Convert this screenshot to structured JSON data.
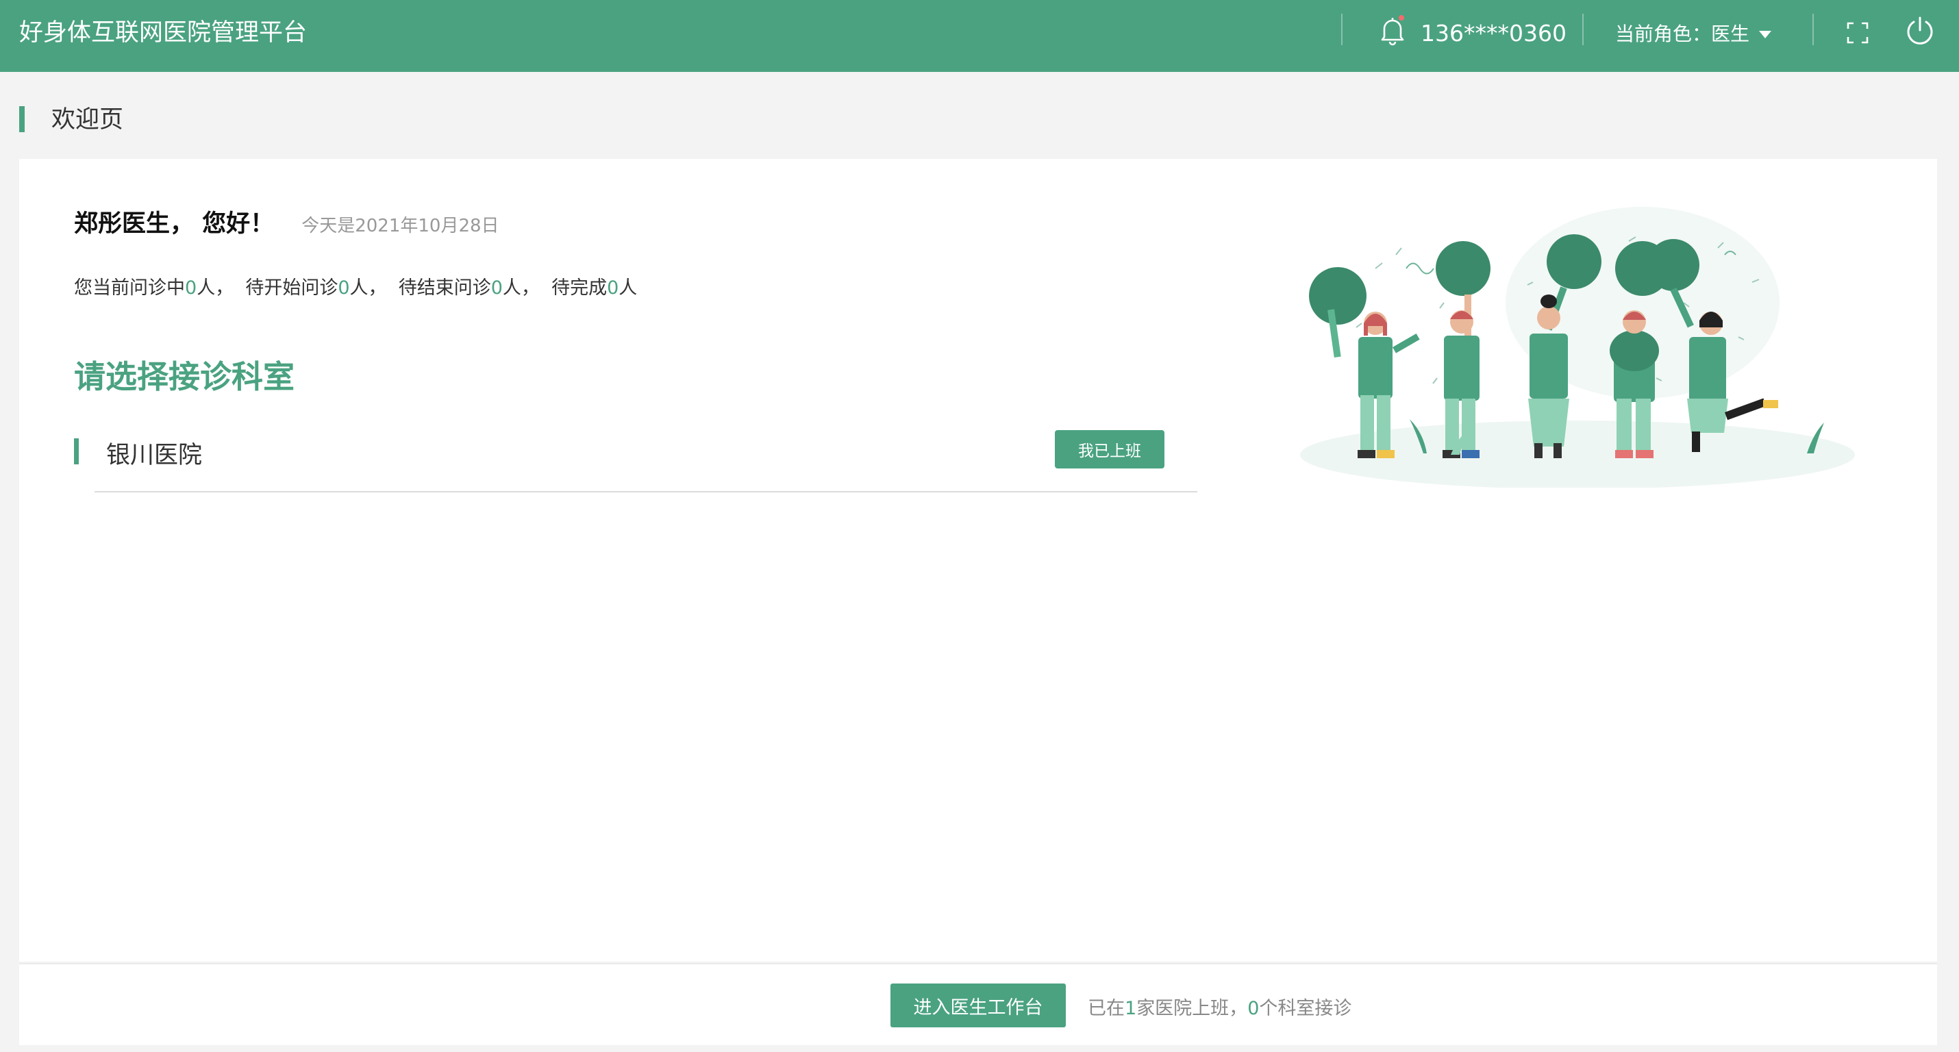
{
  "header": {
    "app_title": "好身体互联网医院管理平台",
    "phone": "136****0360",
    "role_label": "当前角色：医生",
    "colors": {
      "brand": "#4aa281",
      "notify_dot": "#f56c6c"
    },
    "icons": [
      "bell-icon",
      "chevron-down-icon",
      "fullscreen-icon",
      "power-icon"
    ]
  },
  "page": {
    "title": "欢迎页"
  },
  "welcome": {
    "greeting": "郑彤医生， 您好！",
    "date": "今天是2021年10月28日",
    "stats": {
      "l1": "您当前问诊中",
      "v1": "0",
      "u1": "人，",
      "l2": "待开始问诊",
      "v2": "0",
      "u2": "人，",
      "l3": "待结束问诊",
      "v3": "0",
      "u3": "人，",
      "l4": "待完成",
      "v4": "0",
      "u4": "人"
    },
    "choose_title": "请选择接诊科室",
    "hospital": {
      "name": "银川医院",
      "button_label": "我已上班"
    }
  },
  "footer": {
    "enter_button": "进入医生工作台",
    "summary": {
      "p1": "已在",
      "hospitals": "1",
      "p2": "家医院上班，",
      "departments": "0",
      "p3": "个科室接诊"
    }
  }
}
